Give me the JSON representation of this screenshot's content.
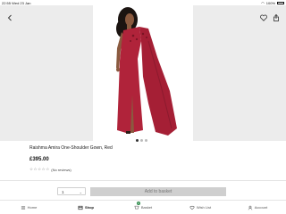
{
  "status_bar": {
    "time": "22:55",
    "date": "Wed 23 Jan",
    "battery": "100%"
  },
  "product": {
    "title": "Raishma Amira One-Shoulder Gown, Red",
    "price": "£395.00",
    "reviews_text": "(No reviews)",
    "rating_stars": 0,
    "image_count": 3,
    "active_image": 1,
    "dress_color": "#b0233a"
  },
  "purchase": {
    "quantity": "1",
    "add_label": "Add to basket"
  },
  "tabs": [
    {
      "label": "Home",
      "icon": "home-icon"
    },
    {
      "label": "Shop",
      "icon": "shop-icon",
      "active": true
    },
    {
      "label": "Basket",
      "icon": "basket-icon",
      "badge": "0"
    },
    {
      "label": "Wish List",
      "icon": "heart-icon"
    },
    {
      "label": "Account",
      "icon": "account-icon"
    }
  ],
  "colors": {
    "accent_green": "#2c8a4a",
    "button_disabled": "#cfcfcf"
  }
}
